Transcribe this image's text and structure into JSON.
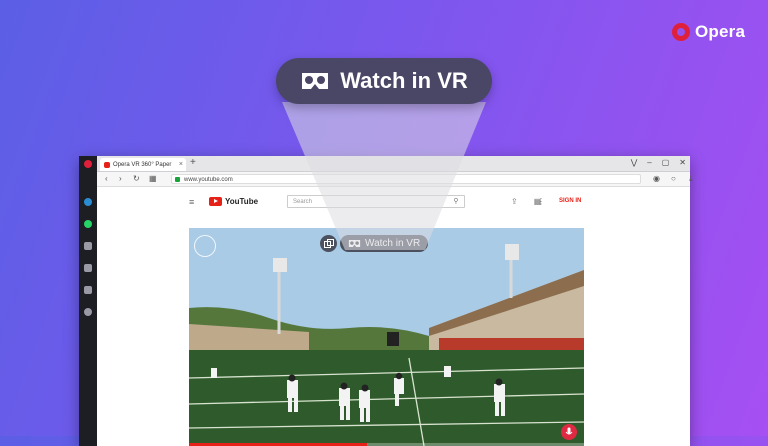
{
  "brand": {
    "name": "Opera"
  },
  "callout": {
    "label": "Watch in VR",
    "icon": "vr-headset-icon"
  },
  "browser": {
    "tab_title": "Opera VR 360° Paper",
    "url": "www.youtube.com",
    "window_controls": [
      "⋁",
      "–",
      "▢",
      "✕"
    ]
  },
  "youtube": {
    "logo_text": "YouTube",
    "search_placeholder": "Search",
    "signin_label": "SIGN IN"
  },
  "video": {
    "vr_button_label": "Watch in VR",
    "progress": 0.45
  },
  "colors": {
    "accent": "#e62117",
    "opera_red": "#e0203a",
    "callout_bg": "#4a4666"
  }
}
